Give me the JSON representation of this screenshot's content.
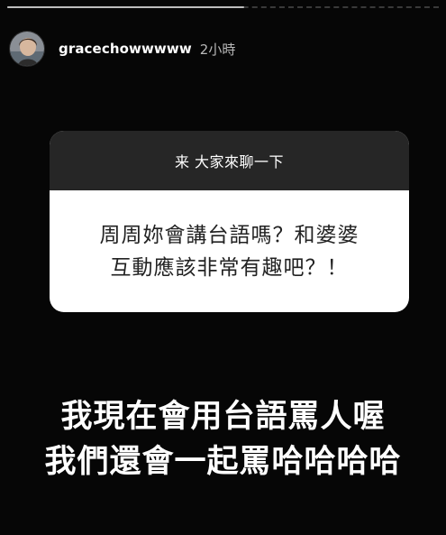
{
  "story": {
    "progress_fraction": 0.55,
    "colors": {
      "background": "#060606",
      "card_header": "#262626",
      "card_body": "#ffffff",
      "question_text": "#222222",
      "reply_text": "#ffffff"
    }
  },
  "header": {
    "avatar_icon": "profile-photo",
    "username": "gracechowwwww",
    "timestamp": "2小時"
  },
  "question_card": {
    "prompt": "来 大家來聊一下",
    "question_lines": [
      "周周妳會講台語嗎？和婆婆",
      "互動應該非常有趣吧？！"
    ]
  },
  "reply": {
    "lines": [
      "我現在會用台語罵人喔",
      "我們還會一起罵哈哈哈哈"
    ]
  }
}
